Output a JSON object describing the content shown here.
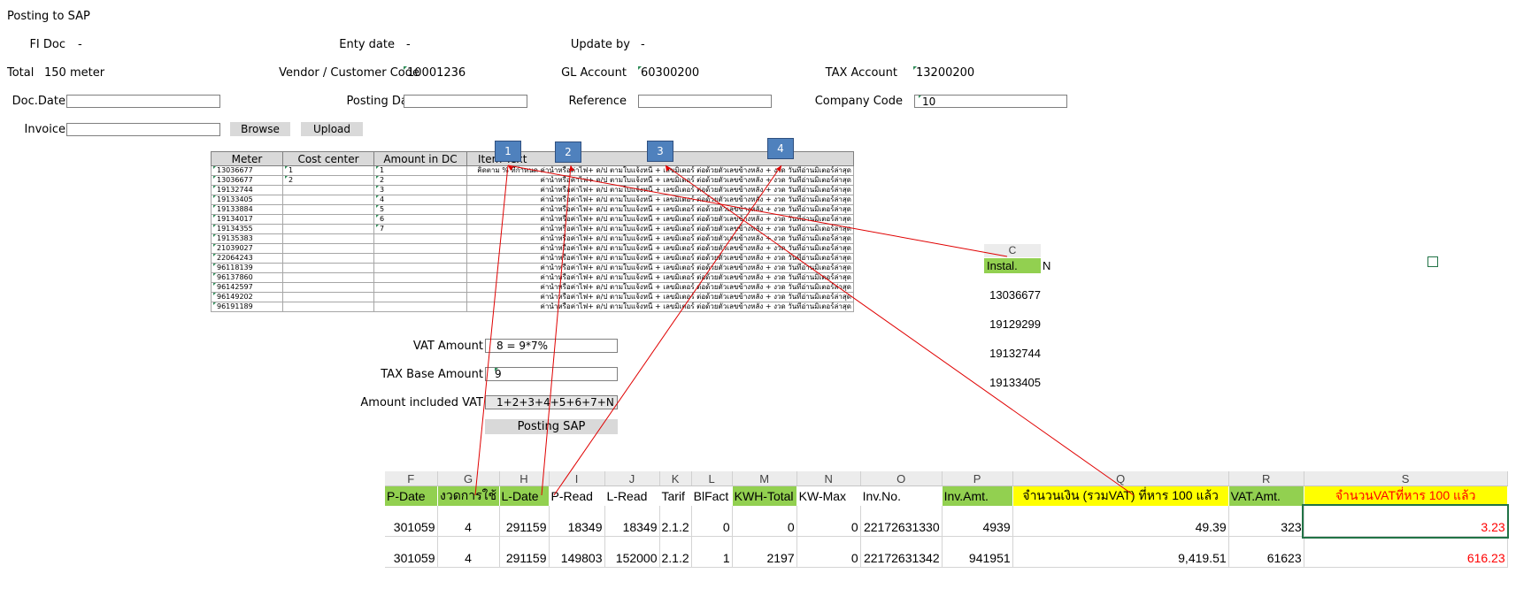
{
  "title": "Posting to SAP",
  "fields": {
    "fi_doc_label": "FI Doc",
    "fi_doc_value": "-",
    "entry_date_label": "Enty date",
    "entry_date_value": "-",
    "update_by_label": "Update by",
    "update_by_value": "-",
    "total_label": "Total",
    "total_value": "150 meter",
    "vendor_label": "Vendor / Customer Code",
    "vendor_value": "10001236",
    "gl_account_label": "GL Account",
    "gl_account_value": "60300200",
    "tax_account_label": "TAX Account",
    "tax_account_value": "13200200",
    "doc_date_label": "Doc.Date",
    "posting_date_label": "Posting Date",
    "reference_label": "Reference",
    "company_code_label": "Company Code",
    "company_code_value": "10",
    "invoice_label": "Invoice"
  },
  "buttons": {
    "browse": "Browse",
    "upload": "Upload",
    "posting_sap": "Posting SAP"
  },
  "meter_table": {
    "headers": [
      "Meter",
      "Cost center",
      "Amount in DC",
      "Item Text"
    ],
    "rows": [
      {
        "meter": "13036677",
        "cost_center": "1",
        "amount": "1",
        "text": "คิดตาม % ที่กำหนด ค่าน้ำหรือค่าไฟ+ ด/ป ตามใบแจ้งหนี้ + เลขมิเตอร์ ต่อด้วยตัวเลขข้างหลัง + งวด วันที่อ่านมิเตอร์ล่าสุด"
      },
      {
        "meter": "13036677",
        "cost_center": "2",
        "amount": "2",
        "text": "ค่าน้ำหรือค่าไฟ+ ด/ป ตามใบแจ้งหนี้ + เลขมิเตอร์ ต่อด้วยตัวเลขข้างหลัง + งวด วันที่อ่านมิเตอร์ล่าสุด"
      },
      {
        "meter": "19132744",
        "cost_center": "",
        "amount": "3",
        "text": "ค่าน้ำหรือค่าไฟ+ ด/ป ตามใบแจ้งหนี้ + เลขมิเตอร์ ต่อด้วยตัวเลขข้างหลัง + งวด วันที่อ่านมิเตอร์ล่าสุด"
      },
      {
        "meter": "19133405",
        "cost_center": "",
        "amount": "4",
        "text": "ค่าน้ำหรือค่าไฟ+ ด/ป ตามใบแจ้งหนี้ + เลขมิเตอร์ ต่อด้วยตัวเลขข้างหลัง + งวด วันที่อ่านมิเตอร์ล่าสุด"
      },
      {
        "meter": "19133884",
        "cost_center": "",
        "amount": "5",
        "text": "ค่าน้ำหรือค่าไฟ+ ด/ป ตามใบแจ้งหนี้ + เลขมิเตอร์ ต่อด้วยตัวเลขข้างหลัง + งวด วันที่อ่านมิเตอร์ล่าสุด"
      },
      {
        "meter": "19134017",
        "cost_center": "",
        "amount": "6",
        "text": "ค่าน้ำหรือค่าไฟ+ ด/ป ตามใบแจ้งหนี้ + เลขมิเตอร์ ต่อด้วยตัวเลขข้างหลัง + งวด วันที่อ่านมิเตอร์ล่าสุด"
      },
      {
        "meter": "19134355",
        "cost_center": "",
        "amount": "7",
        "text": "ค่าน้ำหรือค่าไฟ+ ด/ป ตามใบแจ้งหนี้ + เลขมิเตอร์ ต่อด้วยตัวเลขข้างหลัง + งวด วันที่อ่านมิเตอร์ล่าสุด"
      },
      {
        "meter": "19135383",
        "cost_center": "",
        "amount": "",
        "text": "ค่าน้ำหรือค่าไฟ+ ด/ป ตามใบแจ้งหนี้ + เลขมิเตอร์ ต่อด้วยตัวเลขข้างหลัง + งวด วันที่อ่านมิเตอร์ล่าสุด"
      },
      {
        "meter": "21039027",
        "cost_center": "",
        "amount": "",
        "text": "ค่าน้ำหรือค่าไฟ+ ด/ป ตามใบแจ้งหนี้ + เลขมิเตอร์ ต่อด้วยตัวเลขข้างหลัง + งวด วันที่อ่านมิเตอร์ล่าสุด"
      },
      {
        "meter": "22064243",
        "cost_center": "",
        "amount": "",
        "text": "ค่าน้ำหรือค่าไฟ+ ด/ป ตามใบแจ้งหนี้ + เลขมิเตอร์ ต่อด้วยตัวเลขข้างหลัง + งวด วันที่อ่านมิเตอร์ล่าสุด"
      },
      {
        "meter": "96118139",
        "cost_center": "",
        "amount": "",
        "text": "ค่าน้ำหรือค่าไฟ+ ด/ป ตามใบแจ้งหนี้ + เลขมิเตอร์ ต่อด้วยตัวเลขข้างหลัง + งวด วันที่อ่านมิเตอร์ล่าสุด"
      },
      {
        "meter": "96137860",
        "cost_center": "",
        "amount": "",
        "text": "ค่าน้ำหรือค่าไฟ+ ด/ป ตามใบแจ้งหนี้ + เลขมิเตอร์ ต่อด้วยตัวเลขข้างหลัง + งวด วันที่อ่านมิเตอร์ล่าสุด"
      },
      {
        "meter": "96142597",
        "cost_center": "",
        "amount": "",
        "text": "ค่าน้ำหรือค่าไฟ+ ด/ป ตามใบแจ้งหนี้ + เลขมิเตอร์ ต่อด้วยตัวเลขข้างหลัง + งวด วันที่อ่านมิเตอร์ล่าสุด"
      },
      {
        "meter": "96149202",
        "cost_center": "",
        "amount": "",
        "text": "ค่าน้ำหรือค่าไฟ+ ด/ป ตามใบแจ้งหนี้ + เลขมิเตอร์ ต่อด้วยตัวเลขข้างหลัง + งวด วันที่อ่านมิเตอร์ล่าสุด"
      },
      {
        "meter": "96191189",
        "cost_center": "",
        "amount": "",
        "text": "ค่าน้ำหรือค่าไฟ+ ด/ป ตามใบแจ้งหนี้ + เลขมิเตอร์ ต่อด้วยตัวเลขข้างหลัง + งวด วันที่อ่านมิเตอร์ล่าสุด"
      }
    ]
  },
  "callouts": [
    "1",
    "2",
    "3",
    "4"
  ],
  "summary": {
    "vat_amount_label": "VAT Amount",
    "vat_amount_value": "8 = 9*7%",
    "tax_base_label": "TAX Base Amount",
    "tax_base_value": "9",
    "amount_incl_vat_label": "Amount included VAT",
    "amount_incl_vat_value": "1+2+3+4+5+6+7+N"
  },
  "side_panel": {
    "col_letter": "C",
    "header": "Instal.",
    "header_next": "N",
    "values": [
      "13036677",
      "19129299",
      "19132744",
      "19133405"
    ]
  },
  "sheet": {
    "col_letters": [
      "F",
      "G",
      "H",
      "I",
      "J",
      "K",
      "L",
      "M",
      "N",
      "O",
      "P",
      "Q",
      "R",
      "S"
    ],
    "headers": [
      "P-Date",
      "งวดการใช้",
      "L-Date",
      "P-Read",
      "L-Read",
      "Tarif",
      "BlFact",
      "KWH-Total",
      "KW-Max",
      "Inv.No.",
      "Inv.Amt.",
      "จำนวนเงิน (รวมVAT) ที่หาร 100 แล้ว",
      "VAT.Amt.",
      "จำนวนVATที่หาร 100 แล้ว"
    ],
    "rows": [
      [
        "301059",
        "4",
        "291159",
        "18349",
        "18349",
        "2.1.2",
        "0",
        "0",
        "0",
        "22172631330",
        "4939",
        "49.39",
        "323",
        "3.23"
      ],
      [
        "301059",
        "4",
        "291159",
        "149803",
        "152000",
        "2.1.2",
        "1",
        "2197",
        "0",
        "22172631342",
        "941951",
        "9,419.51",
        "61623",
        "616.23"
      ]
    ]
  },
  "colors": {
    "header_green": "#92d050",
    "header_yellow": "#ffff00",
    "callout_blue": "#4f81bd",
    "arrow_red": "#e00000",
    "red_text": "#ff0000"
  }
}
